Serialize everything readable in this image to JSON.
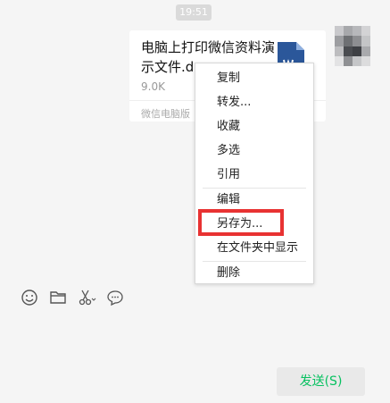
{
  "chat": {
    "timestamp": "19:51",
    "file": {
      "name": "电脑上打印微信资料演示文件.doc",
      "size": "9.0K",
      "source": "微信电脑版"
    }
  },
  "context_menu": {
    "items": [
      {
        "label": "复制"
      },
      {
        "label": "转发..."
      },
      {
        "label": "收藏"
      },
      {
        "label": "多选"
      },
      {
        "label": "引用"
      },
      {
        "label": "编辑"
      },
      {
        "label": "另存为..."
      },
      {
        "label": "在文件夹中显示"
      },
      {
        "label": "删除"
      }
    ],
    "highlighted": "另存为..."
  },
  "toolbar": {
    "icons": [
      "emoji-icon",
      "folder-icon",
      "scissors-icon",
      "chat-bubble-icon"
    ]
  },
  "send_button": {
    "label": "发送(S)"
  },
  "colors": {
    "highlight": "#e83232",
    "send_text": "#07c160",
    "doc_icon": "#2b579a"
  }
}
